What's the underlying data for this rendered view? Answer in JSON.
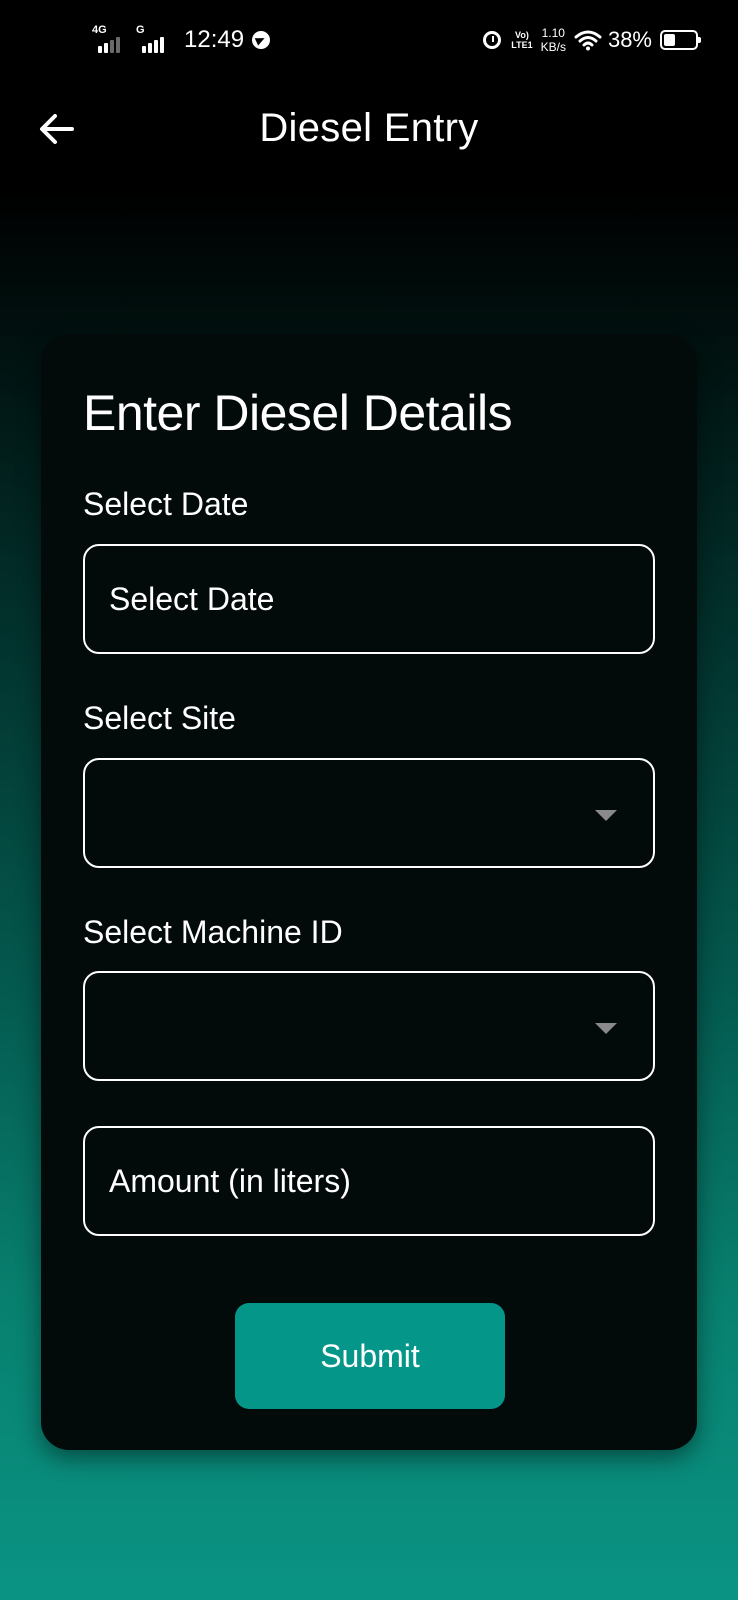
{
  "status_bar": {
    "network_1": "4G",
    "network_2": "G",
    "time": "12:49",
    "volte_top": "Vo)",
    "volte_bottom": "LTE1",
    "speed_value": "1.10",
    "speed_unit": "KB/s",
    "battery_percent": "38%",
    "battery_level": 0.38
  },
  "app_bar": {
    "title": "Diesel Entry",
    "back_icon": "arrow-left-icon"
  },
  "form": {
    "heading": "Enter Diesel Details",
    "date_label": "Select Date",
    "date_placeholder": "Select Date",
    "site_label": "Select Site",
    "site_value": "",
    "machine_label": "Select Machine ID",
    "machine_value": "",
    "amount_placeholder": "Amount (in liters)",
    "submit_label": "Submit"
  },
  "colors": {
    "accent": "#05968a",
    "card_background": "#030a0a",
    "gradient_bottom": "#0a9383"
  }
}
